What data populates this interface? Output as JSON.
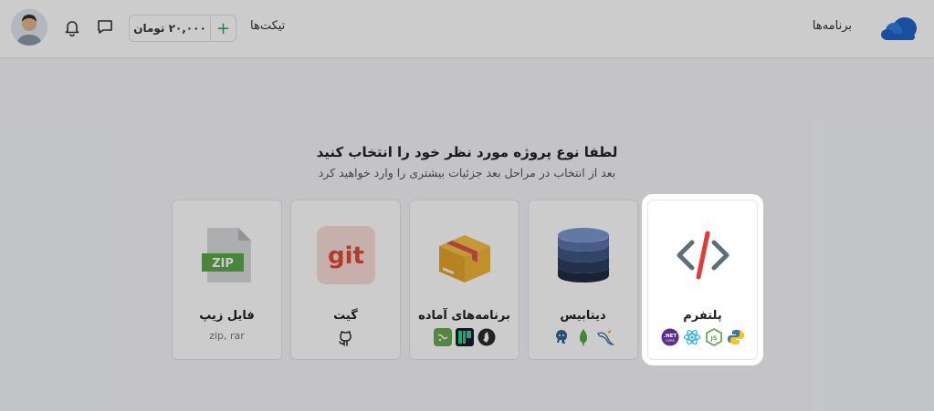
{
  "header": {
    "nav_apps": "برنامه‌ها",
    "nav_tickets": "تیکت‌ها",
    "wallet_amount": "۲۰,۰۰۰ تومان",
    "wallet_add": "+"
  },
  "main": {
    "title": "لطفا نوع پروژه مورد نظر خود را انتخاب کنید",
    "subtitle": "بعد از انتخاب در مراحل بعد جزئیات بیشتری را وارد خواهید کرد"
  },
  "cards": [
    {
      "label": "پلتفرم",
      "icon": "code-icon",
      "techs": [
        "python-icon",
        "nodejs-icon",
        "react-icon",
        "dotnet-icon"
      ],
      "selected": true
    },
    {
      "label": "دیتابیس",
      "icon": "database-icon",
      "techs": [
        "mysql-icon",
        "mongodb-icon",
        "postgresql-icon"
      ]
    },
    {
      "label": "برنامه‌های آماده",
      "icon": "box-icon",
      "techs": [
        "gitea-icon",
        "pycharm-icon",
        "nextjs-icon"
      ]
    },
    {
      "label": "گیت",
      "icon": "git-icon",
      "icon_text": "git",
      "techs": [
        "github-icon"
      ]
    },
    {
      "label": "فایل زیپ",
      "icon": "zip-file-icon",
      "icon_text": "ZIP",
      "sub": "zip, rar"
    }
  ],
  "colors": {
    "accent_red": "#e53935",
    "code_gray": "#5f6f7a",
    "git_red": "#e24a33",
    "zip_green": "#5aa846"
  }
}
